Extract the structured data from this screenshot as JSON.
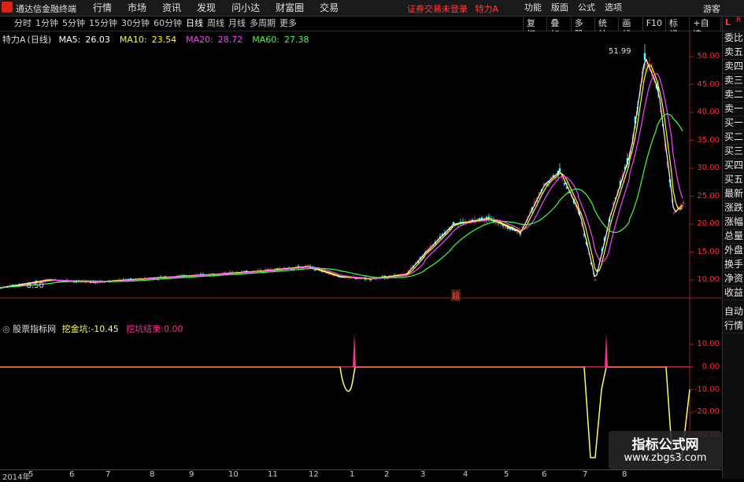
{
  "app": {
    "title": "通达信金融终端",
    "status": "证券交易未登录",
    "stock_label": "特力A",
    "guest_label": "游客"
  },
  "menus": [
    "行情",
    "市场",
    "资讯",
    "发现",
    "问小达",
    "财富圈",
    "交易"
  ],
  "right_menus": [
    "功能",
    "版面",
    "公式",
    "选项"
  ],
  "periods": [
    {
      "label": "分时",
      "active": false
    },
    {
      "label": "1分钟",
      "active": false
    },
    {
      "label": "5分钟",
      "active": false
    },
    {
      "label": "15分钟",
      "active": false
    },
    {
      "label": "30分钟",
      "active": false
    },
    {
      "label": "60分钟",
      "active": false
    },
    {
      "label": "日线",
      "active": true
    },
    {
      "label": "周线",
      "active": false
    },
    {
      "label": "月线",
      "active": false
    },
    {
      "label": "多周期",
      "active": false
    },
    {
      "label": "更多",
      "active": false
    }
  ],
  "tools": [
    "复权",
    "叠加",
    "多股",
    "统计",
    "画线",
    "F10",
    "标记",
    "+自选",
    "返回"
  ],
  "main_legend": {
    "name": "特力A",
    "period": "(日线)",
    "ma": [
      {
        "label": "MA5:",
        "value": "26.03",
        "color": "#ffffff"
      },
      {
        "label": "MA10:",
        "value": "23.54",
        "color": "#ffff00"
      },
      {
        "label": "MA20:",
        "value": "28.72",
        "color": "#ff40ff"
      },
      {
        "label": "MA60:",
        "value": "27.38",
        "color": "#40ff40"
      }
    ]
  },
  "price_axis": [
    "50.00",
    "45.00",
    "40.00",
    "35.00",
    "30.00",
    "25.00",
    "20.00",
    "15.00",
    "10.00"
  ],
  "sub_axis": [
    "10.00",
    "0.00",
    "-10.00",
    "-20.00",
    "-30.00"
  ],
  "annotations": {
    "high": "51.99",
    "low": "8.50",
    "marker": "超"
  },
  "sub_legend": {
    "name": "股票指标网",
    "k1": "挖金坑:",
    "v1": "-10.45",
    "k2": "挖坑结束:",
    "v2": "0.00"
  },
  "sidebar": [
    "委比",
    "卖五",
    "卖四",
    "卖三",
    "卖二",
    "卖一",
    "买一",
    "买二",
    "买三",
    "买四",
    "买五",
    "最新",
    "涨跌",
    "涨幅",
    "总量",
    "外盘",
    "换手",
    "净资",
    "收益"
  ],
  "sidebar_bottom": [
    "自动",
    "行情"
  ],
  "sidebar_top": {
    "l": "L",
    "r": "R"
  },
  "dates": [
    "2014年",
    "5",
    "6",
    "7",
    "8",
    "9",
    "10",
    "11",
    "12",
    "1",
    "2",
    "3",
    "4",
    "5",
    "6",
    "7",
    "8"
  ],
  "watermark": {
    "line1": "指标公式网",
    "line2": "www.zbgs3.com"
  },
  "colors": {
    "axis": "#ff3030",
    "ma5": "#ffffff",
    "ma10": "#ffff00",
    "ma20": "#ff40ff",
    "ma60": "#40ff40",
    "dig": "#ffff60",
    "end": "#ff3090"
  }
}
